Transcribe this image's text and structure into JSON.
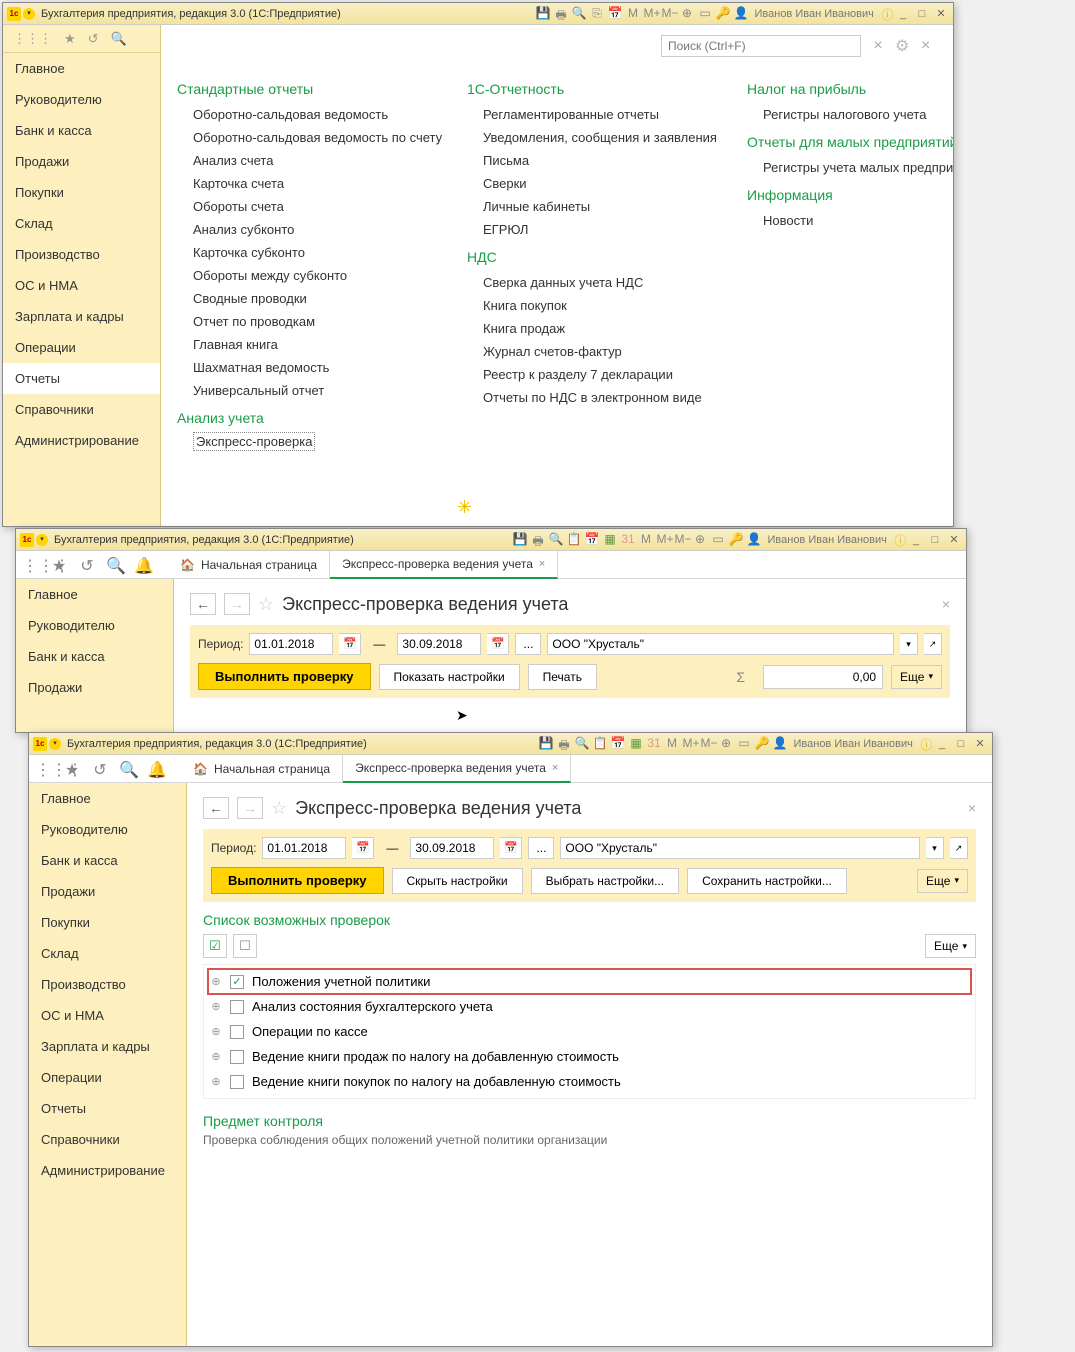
{
  "app_title": "Бухгалтерия предприятия, редакция 3.0  (1С:Предприятие)",
  "user_name": "Иванов Иван Иванович",
  "search_placeholder": "Поиск (Ctrl+F)",
  "sidebar": [
    "Главное",
    "Руководителю",
    "Банк и касса",
    "Продажи",
    "Покупки",
    "Склад",
    "Производство",
    "ОС и НМА",
    "Зарплата и кадры",
    "Операции",
    "Отчеты",
    "Справочники",
    "Администрирование"
  ],
  "sidebar_short": [
    "Главное",
    "Руководителю",
    "Банк и касса",
    "Продажи"
  ],
  "reports": {
    "standard": {
      "title": "Стандартные отчеты",
      "items": [
        "Оборотно-сальдовая ведомость",
        "Оборотно-сальдовая ведомость по счету",
        "Анализ счета",
        "Карточка счета",
        "Обороты счета",
        "Анализ субконто",
        "Карточка субконто",
        "Обороты между субконто",
        "Сводные проводки",
        "Отчет по проводкам",
        "Главная книга",
        "Шахматная ведомость",
        "Универсальный отчет"
      ]
    },
    "analysis": {
      "title": "Анализ учета",
      "express": "Экспресс-проверка"
    },
    "onec": {
      "title": "1С-Отчетность",
      "items": [
        "Регламентированные отчеты",
        "Уведомления, сообщения и заявления",
        "Письма",
        "Сверки",
        "Личные кабинеты",
        "ЕГРЮЛ"
      ]
    },
    "nds": {
      "title": "НДС",
      "items": [
        "Сверка данных учета НДС",
        "Книга покупок",
        "Книга продаж",
        "Журнал счетов-фактур",
        "Реестр к разделу 7 декларации",
        "Отчеты по НДС в электронном виде"
      ]
    },
    "profit": {
      "title": "Налог на прибыль",
      "items": [
        "Регистры налогового учета"
      ]
    },
    "small": {
      "title": "Отчеты для малых предприятий",
      "items": [
        "Регистры учета малых предприятий"
      ]
    },
    "info": {
      "title": "Информация",
      "items": [
        "Новости"
      ]
    }
  },
  "tabs": {
    "home": "Начальная страница",
    "express": "Экспресс-проверка ведения учета"
  },
  "page_title": "Экспресс-проверка ведения учета",
  "period_label": "Период:",
  "date_from": "01.01.2018",
  "date_to": "30.09.2018",
  "org": "ООО \"Хрусталь\"",
  "buttons": {
    "run": "Выполнить проверку",
    "show_settings": "Показать настройки",
    "hide_settings": "Скрыть настройки",
    "select_settings": "Выбрать настройки...",
    "save_settings": "Сохранить настройки...",
    "print": "Печать",
    "more": "Еще"
  },
  "sum_value": "0,00",
  "checks_title": "Список возможных проверок",
  "checks": [
    {
      "label": "Положения учетной политики",
      "checked": true,
      "hl": true
    },
    {
      "label": "Анализ состояния бухгалтерского учета",
      "checked": false
    },
    {
      "label": "Операции по кассе",
      "checked": false
    },
    {
      "label": "Ведение книги продаж по налогу на добавленную стоимость",
      "checked": false
    },
    {
      "label": "Ведение книги покупок по налогу на добавленную стоимость",
      "checked": false
    }
  ],
  "subject": {
    "title": "Предмет контроля",
    "desc": "Проверка соблюдения общих положений учетной политики организации"
  }
}
